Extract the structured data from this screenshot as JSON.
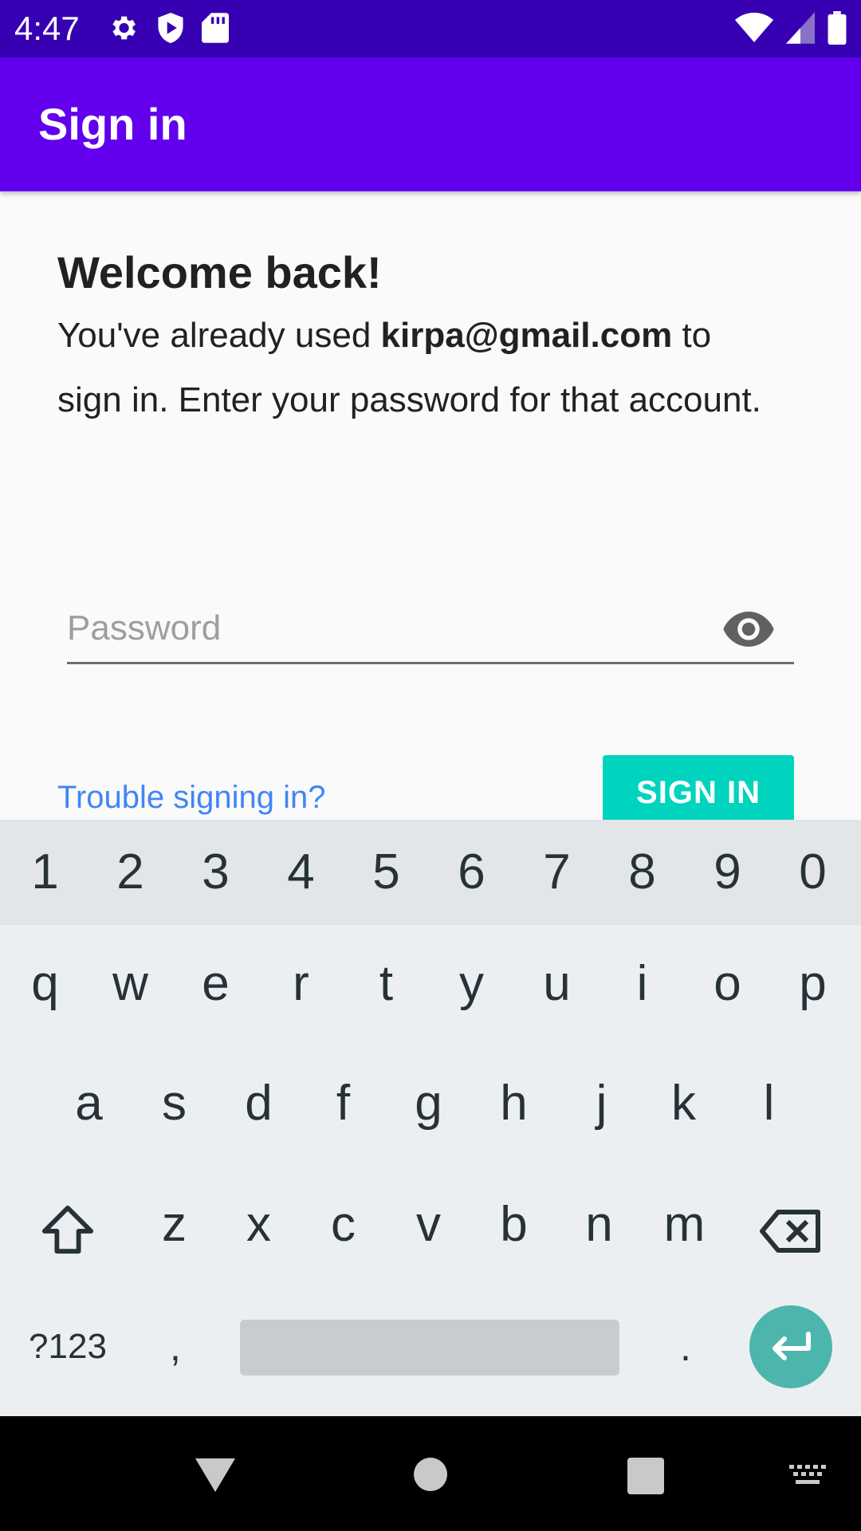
{
  "status_bar": {
    "time": "4:47"
  },
  "app_bar": {
    "title": "Sign in"
  },
  "content": {
    "heading": "Welcome back!",
    "message_prefix": "You've already used ",
    "email": "kirpa@gmail.com",
    "message_suffix": " to sign in. Enter your password for that account.",
    "password": {
      "placeholder": "Password",
      "value": ""
    },
    "trouble_link": "Trouble signing in?",
    "signin_button": "SIGN IN"
  },
  "keyboard": {
    "number_row": [
      "1",
      "2",
      "3",
      "4",
      "5",
      "6",
      "7",
      "8",
      "9",
      "0"
    ],
    "row1": [
      "q",
      "w",
      "e",
      "r",
      "t",
      "y",
      "u",
      "i",
      "o",
      "p"
    ],
    "row2": [
      "a",
      "s",
      "d",
      "f",
      "g",
      "h",
      "j",
      "k",
      "l"
    ],
    "row3": [
      "z",
      "x",
      "c",
      "v",
      "b",
      "n",
      "m"
    ],
    "symbols_key": "?123",
    "comma_key": ",",
    "period_key": "."
  },
  "colors": {
    "status_bar": "#3700b3",
    "app_bar": "#6200ee",
    "sign_in_button": "#00d3be",
    "link": "#4285f4",
    "enter_key": "#4db6ac"
  }
}
